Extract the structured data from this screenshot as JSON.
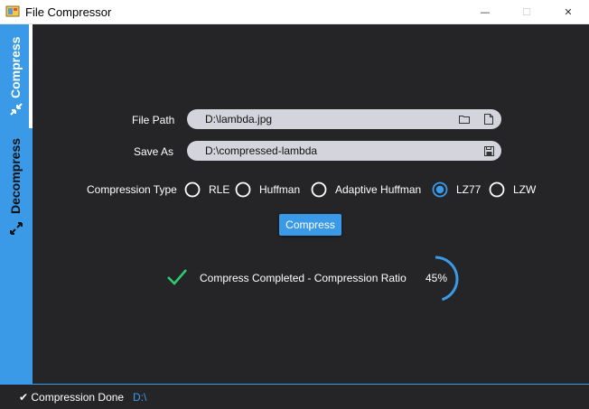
{
  "window": {
    "title": "File Compressor",
    "minimize": "—",
    "maximize": "☐",
    "close": "✕"
  },
  "sidebar": {
    "tabs": [
      {
        "label": "Compress"
      },
      {
        "label": "Decompress"
      }
    ]
  },
  "form": {
    "file_path_label": "File Path",
    "file_path_value": "D:\\lambda.jpg",
    "save_as_label": "Save As",
    "save_as_value": "D:\\compressed-lambda",
    "compression_type_label": "Compression Type",
    "options": [
      {
        "label": "RLE",
        "selected": false
      },
      {
        "label": "Huffman",
        "selected": false
      },
      {
        "label": "Adaptive Huffman",
        "selected": false
      },
      {
        "label": "LZ77",
        "selected": true
      },
      {
        "label": "LZW",
        "selected": false
      }
    ],
    "compress_button": "Compress"
  },
  "result": {
    "message": "Compress Completed - Compression Ratio",
    "ratio_text": "45%",
    "ratio_fraction": 0.45
  },
  "status": {
    "text": "✔ Compression Done",
    "path": "D:\\"
  },
  "colors": {
    "accent": "#3b9ae8",
    "background": "#252528",
    "field": "#d4d4dc",
    "success": "#2ecc71"
  }
}
